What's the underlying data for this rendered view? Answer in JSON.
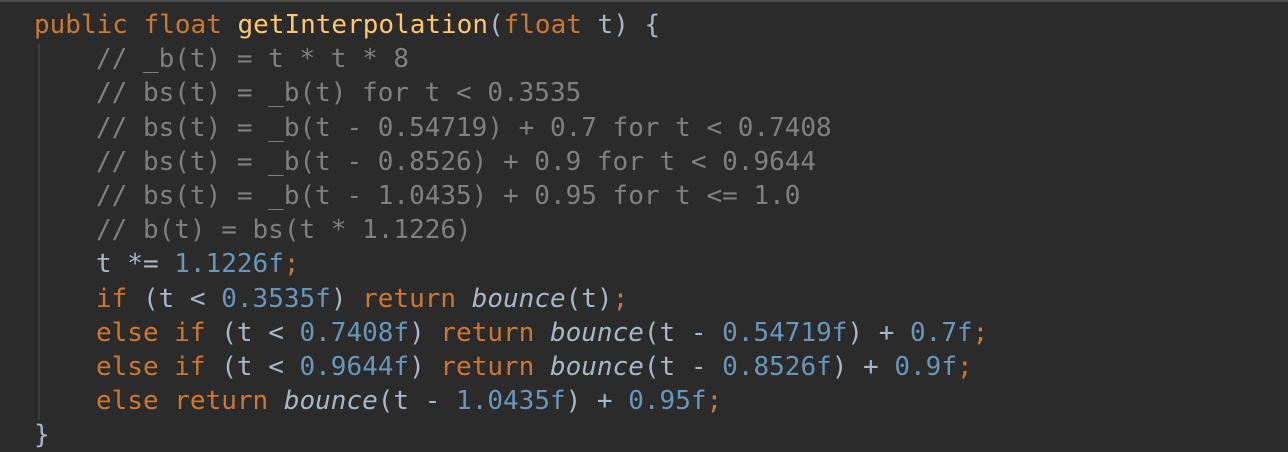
{
  "code": {
    "header": [
      "public",
      " ",
      "float",
      " ",
      "getInterpolation",
      "(",
      "float",
      " t) {"
    ],
    "comments": [
      "// _b(t) = t * t * 8",
      "// bs(t) = _b(t) for t < 0.3535",
      "// bs(t) = _b(t - 0.54719) + 0.7 for t < 0.7408",
      "// bs(t) = _b(t - 0.8526) + 0.9 for t < 0.9644",
      "// bs(t) = _b(t - 1.0435) + 0.95 for t <= 1.0",
      "// b(t) = bs(t * 1.1226)"
    ],
    "line8": [
      "t *= ",
      "1.1226f",
      ";"
    ],
    "line9": [
      "if",
      " (t < ",
      "0.3535f",
      ") ",
      "return",
      " ",
      "bounce",
      "(t)",
      ";"
    ],
    "line10": [
      "else if",
      " (t < ",
      "0.7408f",
      ") ",
      "return",
      " ",
      "bounce",
      "(t - ",
      "0.54719f",
      ") + ",
      "0.7f",
      ";"
    ],
    "line11": [
      "else if",
      " (t < ",
      "0.9644f",
      ") ",
      "return",
      " ",
      "bounce",
      "(t - ",
      "0.8526f",
      ") + ",
      "0.9f",
      ";"
    ],
    "line12": [
      "else return",
      " ",
      "bounce",
      "(t - ",
      "1.0435f",
      ") + ",
      "0.95f",
      ";"
    ],
    "closing": "}"
  },
  "colors": {
    "background": "#2b2b2b",
    "keyword": "#cc7832",
    "function": "#ffc66d",
    "number": "#6897bb",
    "comment": "#808080",
    "identifier": "#a9b7c6"
  }
}
